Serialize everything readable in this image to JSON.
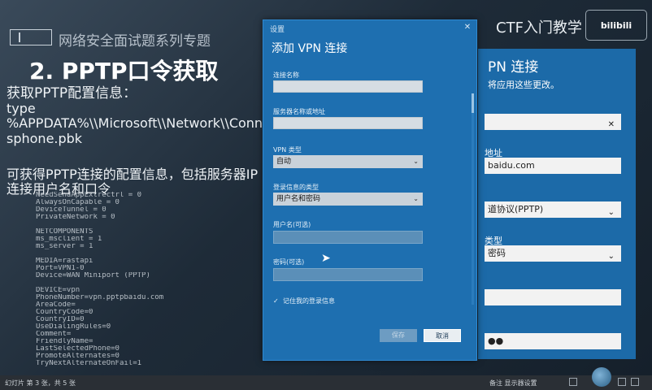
{
  "slide": {
    "series_title": "网络安全面试题系列专题",
    "heading": "2. PPTP口令获取",
    "lines": [
      "获取PPTP配置信息：",
      "type",
      "%APPDATA%\\\\Microsoft\\\\Network\\\\Connectio",
      "sphone.pbk",
      "可获得PPTP连接的配置信息，包括服务器IP",
      "连接用户名和口令"
    ],
    "ctf_label": "CTF入门教学",
    "logo_text": "bilibili",
    "code_lines": [
      "NeedSendAppExtrectrl = 0",
      "AlwaysOnCapable = 0",
      "DeviceTunnel = 0",
      "PrivateNetwork = 0",
      "",
      "NETCOMPONENTS",
      "ms_msclient = 1",
      "ms_server = 1",
      "",
      "MEDIA=rastapi",
      "Port=VPN1-0",
      "Device=WAN Miniport (PPTP)",
      "",
      "DEVICE=vpn",
      "PhoneNumber=vpn.pptpbaidu.com",
      "AreaCode=",
      "CountryCode=0",
      "CountryID=0",
      "UseDialingRules=0",
      "Comment=",
      "FriendlyName=",
      "LastSelectedPhone=0",
      "PromoteAlternates=0",
      "TryNextAlternateOnFail=1"
    ]
  },
  "bg_dialog": {
    "title": "PN 连接",
    "subtitle": "将应用这些更改。",
    "server_label": "地址",
    "server_value": "baidu.com",
    "type_value": "道协议(PPTP)",
    "signin_label": "类型",
    "signin_value": "密码",
    "password_value": "●●"
  },
  "dialog": {
    "caption": "设置",
    "close": "✕",
    "title": "添加 VPN 连接",
    "conn_name_label": "连接名称",
    "server_label": "服务器名称或地址",
    "vpn_type_label": "VPN 类型",
    "vpn_type_value": "自动",
    "signin_type_label": "登录信息的类型",
    "signin_type_value": "用户名和密码",
    "username_label": "用户名(可选)",
    "password_label": "密码(可选)",
    "remember_label": "记住我的登录信息",
    "save_button": "保存",
    "cancel_button": "取消"
  },
  "statusbar": {
    "slide_info": "幻灯片 第 3 张，共 5 张",
    "notes": "备注  显示器设置"
  }
}
